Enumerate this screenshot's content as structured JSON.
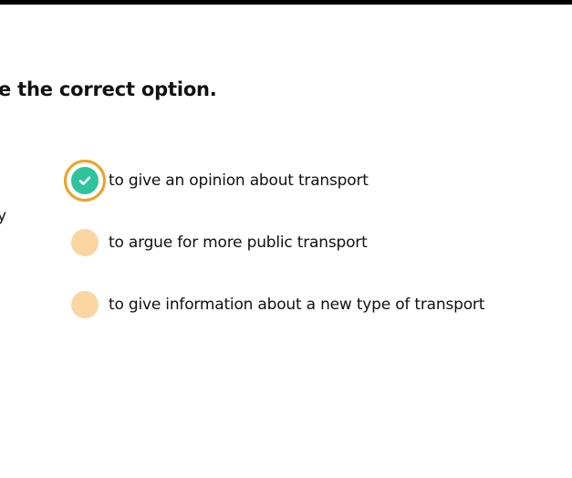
{
  "instruction": "e the correct option.",
  "left_fragment": "y",
  "options": [
    {
      "label": "to give an opinion about transport",
      "selected": true
    },
    {
      "label": "to argue for more public transport",
      "selected": false
    },
    {
      "label": "to give information about a new type of transport",
      "selected": false
    }
  ],
  "colors": {
    "top_bar": "#000000",
    "radio_unselected": "#fbd6a2",
    "radio_selected_ring": "#f2a023",
    "radio_selected_fill": "#2ec49b",
    "check_icon": "#ffffff"
  },
  "icons": {
    "selected_mark": "check-icon"
  }
}
